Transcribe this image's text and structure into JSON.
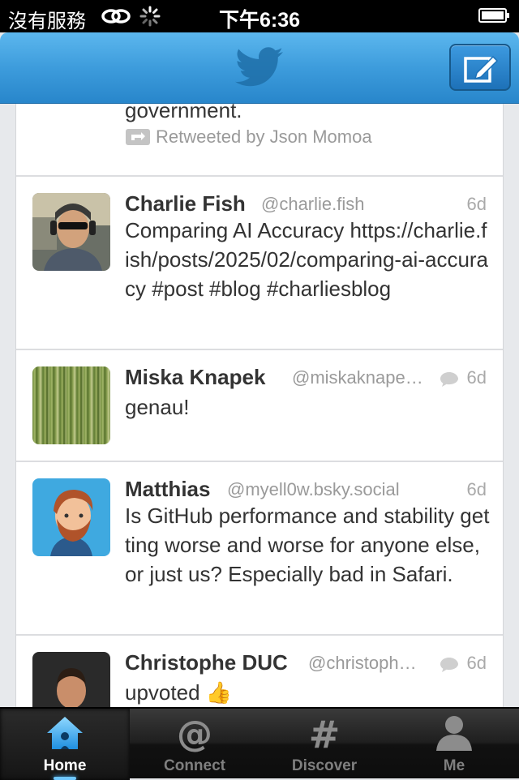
{
  "status_bar": {
    "carrier": "沒有服務",
    "time": "下午6:36"
  },
  "nav": {
    "logo_icon": "twitter-bird-icon",
    "compose_icon": "compose-icon"
  },
  "colors": {
    "nav_blue": "#3d9cdc",
    "text": "#333333",
    "muted": "#9a9a9a",
    "tab_active_glow": "#6ec7ff"
  },
  "timeline": {
    "partial_tweet": {
      "text": "government.",
      "retweeted_by": "Retweeted by Json Momoa"
    },
    "tweets": [
      {
        "name": "Charlie Fish",
        "handle": "@charlie.fish",
        "time": "6d",
        "text": "Comparing AI Accuracy https://charlie.fish/posts/2025/02/comparing-ai-accuracy #post #blog #charliesblog"
      },
      {
        "name": "Miska Knapek",
        "handle": "@miskaknape…",
        "time": "6d",
        "text": "genau!"
      },
      {
        "name": "Matthias",
        "handle": "@myell0w.bsky.social",
        "time": "6d",
        "text": "Is GitHub performance and stability getting worse and worse for anyone else, or just us? Especially bad in Safari."
      },
      {
        "name": "Christophe DUC",
        "handle": "@christoph…",
        "time": "6d",
        "text": "upvoted 👍"
      }
    ]
  },
  "tabs": [
    {
      "label": "Home",
      "icon": "home-icon",
      "active": true
    },
    {
      "label": "Connect",
      "icon": "at-icon",
      "active": false
    },
    {
      "label": "Discover",
      "icon": "hashtag-icon",
      "active": false
    },
    {
      "label": "Me",
      "icon": "person-icon",
      "active": false
    }
  ]
}
